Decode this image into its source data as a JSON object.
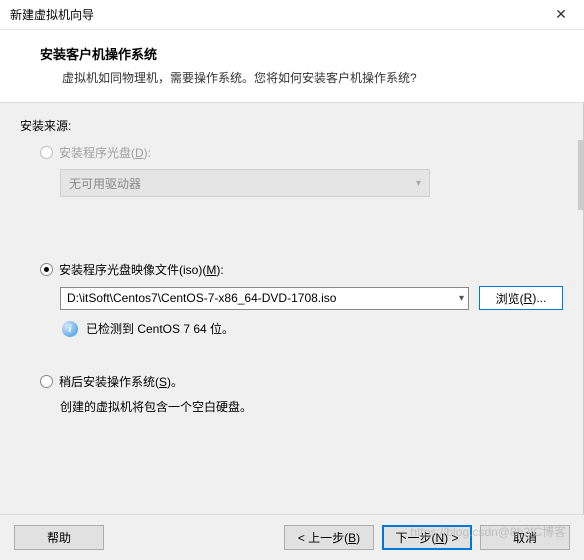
{
  "titlebar": {
    "title": "新建虚拟机向导"
  },
  "header": {
    "heading": "安装客户机操作系统",
    "sub": "虚拟机如同物理机，需要操作系统。您将如何安装客户机操作系统?"
  },
  "body": {
    "section_label": "安装来源:",
    "disc": {
      "label_pre": "安装程序光盘(",
      "label_key": "D",
      "label_post": "):",
      "combo": "无可用驱动器"
    },
    "iso": {
      "label_pre": "安装程序光盘映像文件(iso)(",
      "label_key": "M",
      "label_post": "):",
      "path": "D:\\itSoft\\Centos7\\CentOS-7-x86_64-DVD-1708.iso",
      "browse_pre": "浏览(",
      "browse_key": "R",
      "browse_post": ")...",
      "info": "已检测到 CentOS 7 64 位。"
    },
    "later": {
      "label_pre": "稍后安装操作系统(",
      "label_key": "S",
      "label_post": ")。",
      "desc": "创建的虚拟机将包含一个空白硬盘。"
    }
  },
  "footer": {
    "help": "帮助",
    "back_pre": "< 上一步(",
    "back_key": "B",
    "back_post": ")",
    "next_pre": "下一步(",
    "next_key": "N",
    "next_post": ") >",
    "cancel": "取消"
  },
  "watermark": "https://blog.csdn@8h2fC博客"
}
